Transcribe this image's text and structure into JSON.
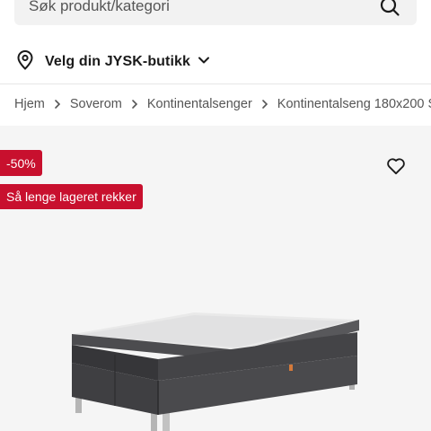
{
  "search": {
    "placeholder": "Søk produkt/kategori"
  },
  "store": {
    "label": "Velg din JYSK-butikk"
  },
  "breadcrumb": [
    "Hjem",
    "Soverom",
    "Kontinentalsenger",
    "Kontinentalseng 180x200 S"
  ],
  "badges": {
    "discount": "-50%",
    "stock": "Så lenge lageret rekker"
  },
  "icons": {
    "search": "search-icon",
    "location": "map-pin-icon",
    "dropdown": "chevron-down-icon",
    "breadcrumb_separator": "chevron-right-icon",
    "wishlist": "heart-icon"
  },
  "colors": {
    "badge": "#c8102e",
    "search_bg": "#f2f2f2",
    "product_bg": "#f5f5f5"
  }
}
